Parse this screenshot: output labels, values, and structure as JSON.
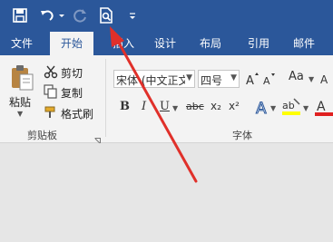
{
  "colors": {
    "accent": "#2b579a",
    "ribbon_bg": "#f3f3f3",
    "document_bg": "#e6e6e6",
    "annotation_arrow": "#e0302a",
    "font_color_bar": "#e02020",
    "highlight_bar": "#ffff00"
  },
  "quick_access": {
    "icons": [
      "save-icon",
      "undo-icon",
      "redo-icon",
      "print-preview-icon",
      "customize-qat-icon"
    ]
  },
  "tabs": [
    {
      "label": "文件",
      "active": false
    },
    {
      "label": "开始",
      "active": true
    },
    {
      "label": "插入",
      "active": false
    },
    {
      "label": "设计",
      "active": false
    },
    {
      "label": "布局",
      "active": false
    },
    {
      "label": "引用",
      "active": false
    },
    {
      "label": "邮件",
      "active": false
    }
  ],
  "clipboard": {
    "paste_label": "粘贴",
    "cut_label": "剪切",
    "copy_label": "复制",
    "format_painter_label": "格式刷",
    "group_label": "剪贴板"
  },
  "font": {
    "font_name": "宋体 (中文正文",
    "font_size": "四号",
    "group_label": "字体",
    "aa_label": "Aa",
    "bold": "B",
    "italic": "I",
    "underline": "U",
    "strikethrough": "abc",
    "subscript": "x₂",
    "superscript": "x²",
    "text_effect": "A",
    "highlight": "ab",
    "font_color": "A"
  }
}
